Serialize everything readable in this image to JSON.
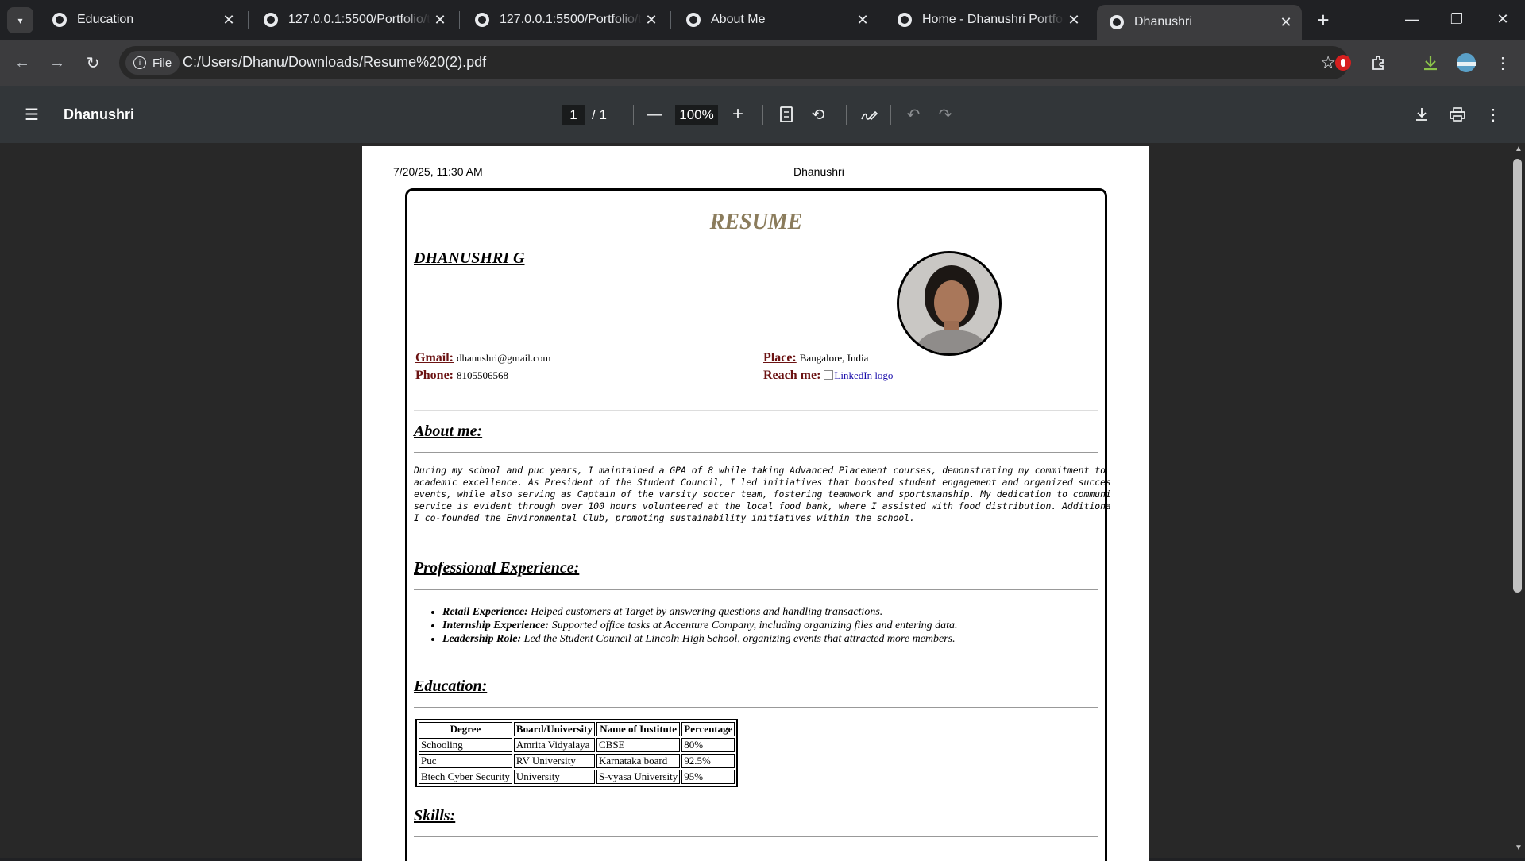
{
  "tabs": [
    {
      "title": "Education"
    },
    {
      "title": "127.0.0.1:5500/Portfolio/templates/"
    },
    {
      "title": "127.0.0.1:5500/Portfolio/templates/"
    },
    {
      "title": "About Me"
    },
    {
      "title": "Home - Dhanushri Portfolio"
    },
    {
      "title": "Dhanushri"
    }
  ],
  "tab_close": "✕",
  "new_tab": "+",
  "window": {
    "minimize": "—",
    "restore": "❐",
    "close": "✕"
  },
  "address": {
    "chip": "File",
    "url": "C:/Users/Dhanu/Downloads/Resume%20(2).pdf"
  },
  "pdf": {
    "title": "Dhanushri",
    "page": "1",
    "total": "/   1",
    "zoom": "100%"
  },
  "page_header": {
    "date": "7/20/25, 11:30 AM",
    "title": "Dhanushri"
  },
  "resume": {
    "heading": "RESUME",
    "name": "DHANUSHRI G",
    "gmail_label": "Gmail:",
    "gmail": "dhanushri@gmail.com",
    "phone_label": "Phone:",
    "phone": "8105506568",
    "place_label": "Place:",
    "place": "Bangalore, India",
    "reach_label": "Reach me:",
    "reach_link": "LinkedIn logo",
    "about_heading": "About me:",
    "about_text": "During my school and puc years, I maintained a GPA of 8 while taking Advanced Placement courses, demonstrating my commitment to\nacademic excellence. As President of the Student Council, I led initiatives that boosted student engagement and organized succes\nevents, while also serving as Captain of the varsity soccer team, fostering teamwork and sportsmanship. My dedication to communi\nservice is evident through over 100 hours volunteered at the local food bank, where I assisted with food distribution. Additiona\nI co-founded the Environmental Club, promoting sustainability initiatives within the school.",
    "experience_heading": "Professional Experience:",
    "experience": [
      {
        "label": "Retail Experience:",
        "text": " Helped customers at Target by answering questions and handling transactions."
      },
      {
        "label": "Internship Experience:",
        "text": " Supported office tasks at Accenture Company, including organizing files and entering data."
      },
      {
        "label": "Leadership Role:",
        "text": " Led the Student Council at Lincoln High School, organizing events that attracted more members."
      }
    ],
    "education_heading": "Education:",
    "education_columns": [
      "Degree",
      "Board/University",
      "Name of Institute",
      "Percentage"
    ],
    "education_rows": [
      [
        "Schooling",
        "Amrita Vidyalaya",
        "CBSE",
        "80%"
      ],
      [
        "Puc",
        "RV University",
        "Karnataka board",
        "92.5%"
      ],
      [
        "Btech Cyber Security",
        "University",
        "S-vyasa University",
        "95%"
      ]
    ],
    "skills_heading": "Skills:"
  }
}
